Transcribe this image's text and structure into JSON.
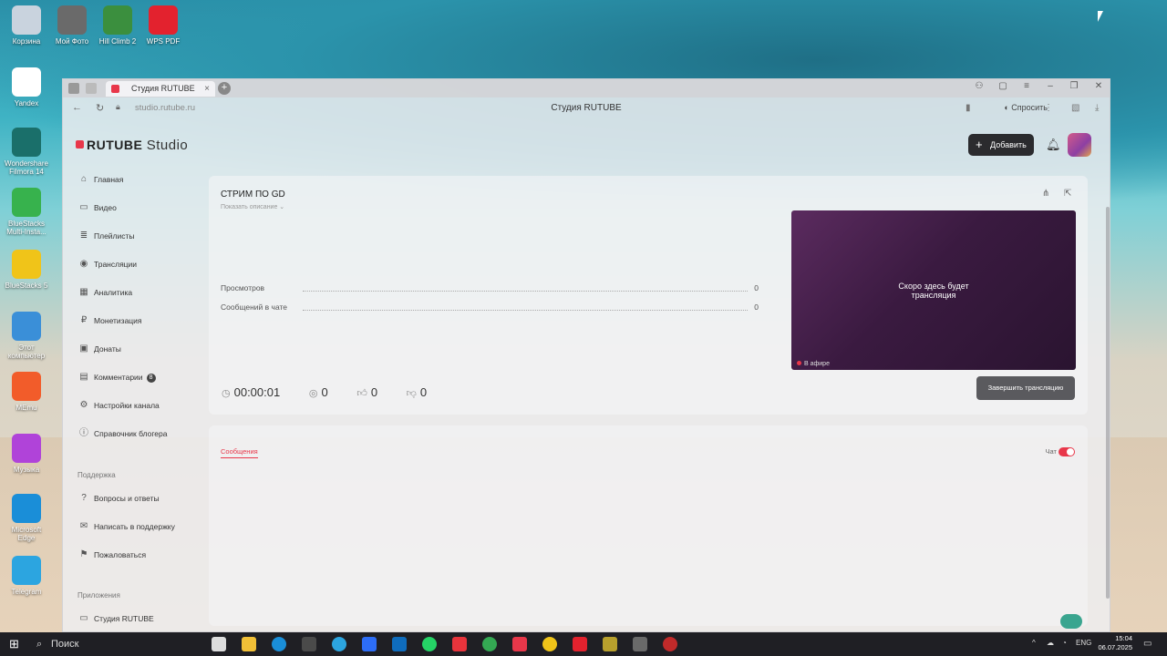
{
  "desktop": {
    "icons": [
      {
        "label": "Корзина",
        "color": "#c9d3de"
      },
      {
        "label": "Мой Фото",
        "color": "#6a6a6a"
      },
      {
        "label": "Hill Climb 2",
        "color": "#3b8f3e"
      },
      {
        "label": "WPS PDF",
        "color": "#e3222e"
      },
      {
        "label": "Yandex",
        "color": "#ffffff"
      },
      {
        "label": "Wondershare Filmora 14",
        "color": "#1a6f6a"
      },
      {
        "label": "BlueStacks Multi-Insta...",
        "color": "#37b24d"
      },
      {
        "label": "BlueStacks 5",
        "color": "#f0c419"
      },
      {
        "label": "Этот компьютер",
        "color": "#3a8fd8"
      },
      {
        "label": "MEmu",
        "color": "#f25c2a"
      },
      {
        "label": "Музыка",
        "color": "#b043d9"
      },
      {
        "label": "Microsoft Edge",
        "color": "#1a8ed8"
      },
      {
        "label": "Telegram",
        "color": "#2ca5e0"
      }
    ]
  },
  "browser": {
    "tab_title": "Студия RUTUBE",
    "tab_close": "×",
    "new_tab": "+",
    "url": "studio.rutube.ru",
    "page_title": "Студия RUTUBE",
    "ask_label": "Спросить"
  },
  "studio": {
    "logo_main": "RUTUBE",
    "logo_studio": "Studio",
    "add_button": "Добавить",
    "sidebar": [
      {
        "label": "Главная",
        "icon": "⌂"
      },
      {
        "label": "Видео",
        "icon": "▭"
      },
      {
        "label": "Плейлисты",
        "icon": "≣"
      },
      {
        "label": "Трансляции",
        "icon": "◉"
      },
      {
        "label": "Аналитика",
        "icon": "▦"
      },
      {
        "label": "Монетизация",
        "icon": "₽"
      },
      {
        "label": "Донаты",
        "icon": "▣"
      },
      {
        "label": "Комментарии",
        "icon": "▤",
        "badge": "8"
      },
      {
        "label": "Настройки канала",
        "icon": "⚙"
      },
      {
        "label": "Справочник блогера",
        "icon": "ⓘ"
      }
    ],
    "support_section": "Поддержка",
    "support_items": [
      {
        "label": "Вопросы и ответы",
        "icon": "?"
      },
      {
        "label": "Написать в поддержку",
        "icon": "✉"
      },
      {
        "label": "Пожаловаться",
        "icon": "⚑"
      }
    ],
    "apps_section": "Приложения",
    "apps_items": [
      {
        "label": "Студия RUTUBE",
        "icon": "▭"
      }
    ],
    "stream": {
      "title": "СТРИМ ПО GD",
      "show_description": "Показать описание ⌄",
      "stats": [
        {
          "label": "Просмотров",
          "value": "0"
        },
        {
          "label": "Сообщений в чате",
          "value": "0"
        }
      ],
      "timer": "00:00:01",
      "viewers": "0",
      "likes": "0",
      "dislikes": "0",
      "preview_text_line1": "Скоро здесь будет",
      "preview_text_line2": "трансляция",
      "preview_badge": "В афире",
      "end_button": "Завершить трансляцию"
    },
    "chat": {
      "tab_label": "Сообщения",
      "toggle_label": "Чат",
      "enabled": true
    }
  },
  "taskbar": {
    "search_placeholder": "Поиск",
    "language": "ENG",
    "time": "15:04",
    "date": "06.07.2025"
  }
}
